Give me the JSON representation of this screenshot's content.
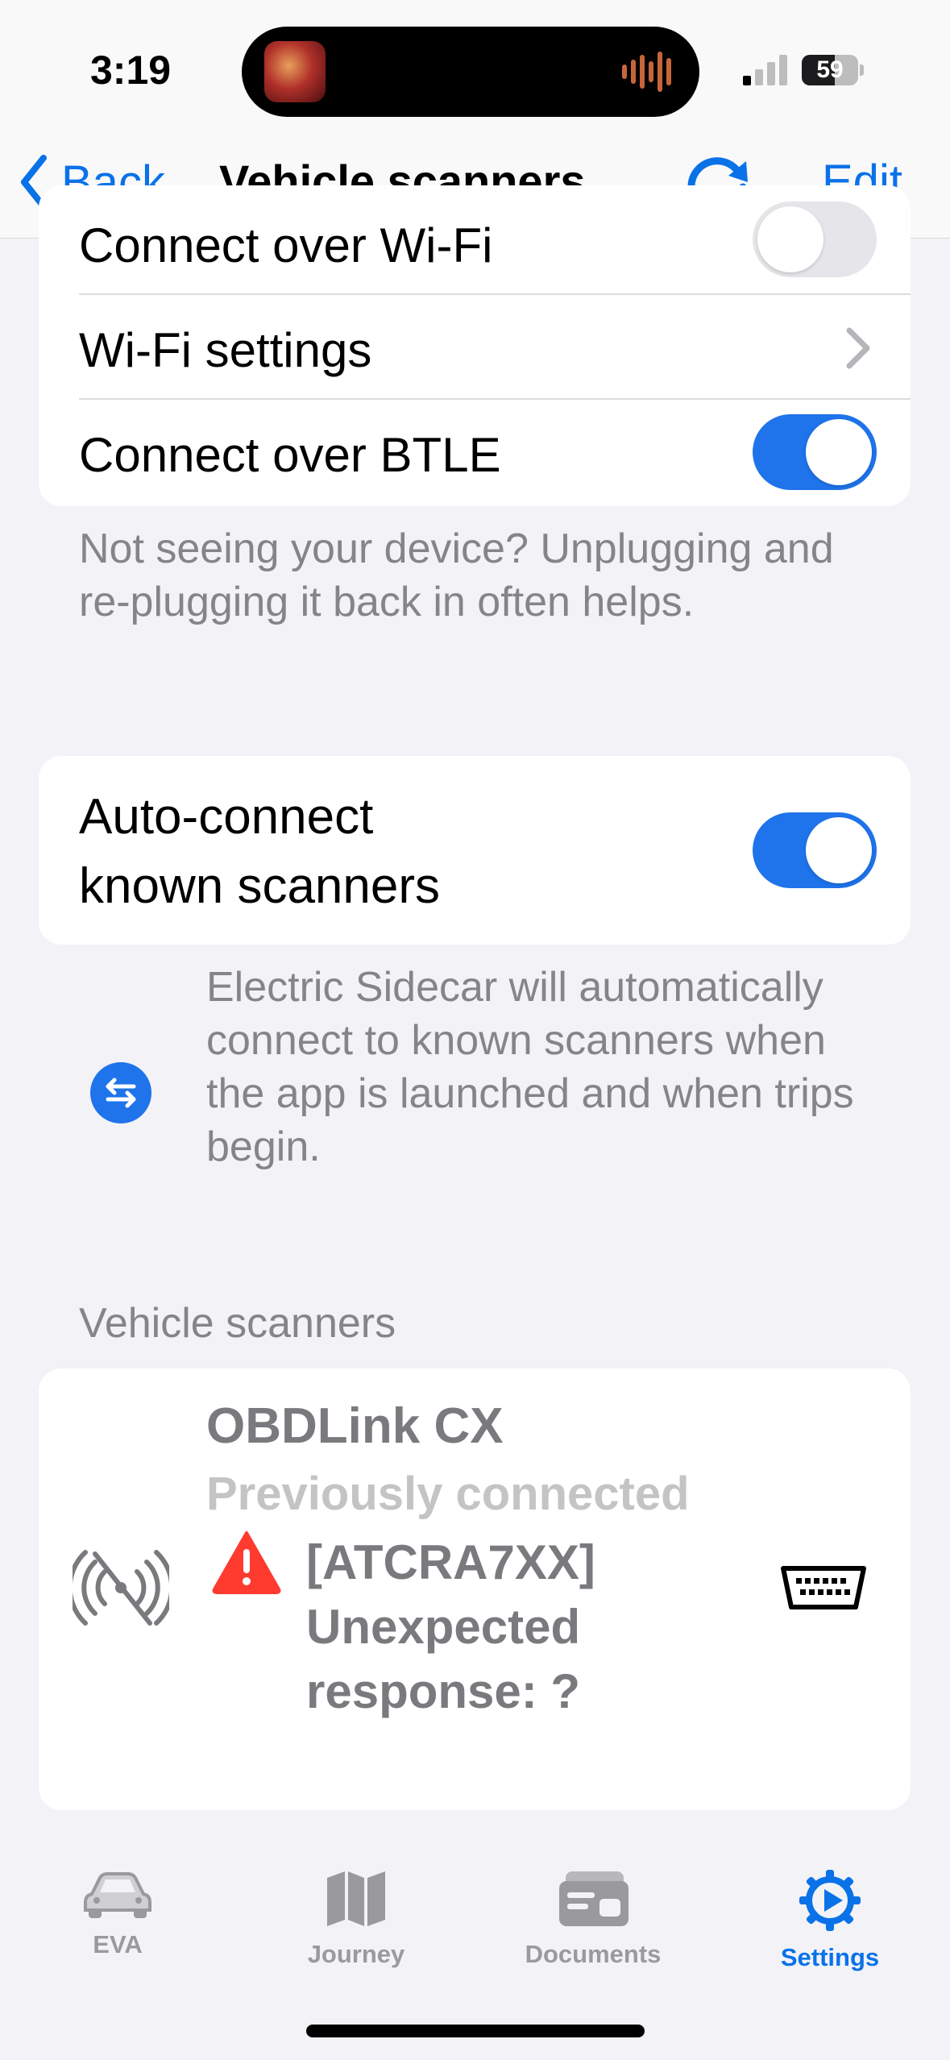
{
  "status_bar": {
    "time": "3:19",
    "battery_level": "59",
    "battery_fraction": 0.59
  },
  "nav": {
    "back_label": "Back",
    "title": "Vehicle scanners",
    "refresh_icon": "refresh-icon",
    "edit_label": "Edit"
  },
  "connection_settings": {
    "wifi_label": "Connect over Wi-Fi",
    "wifi_enabled": false,
    "wifi_settings_label": "Wi-Fi settings",
    "btle_label": "Connect over BTLE",
    "btle_enabled": true
  },
  "connection_footnote": "Not seeing your device? Unplugging and re-plugging it back in often helps.",
  "auto_connect": {
    "label_line1": "Auto-connect",
    "label_line2": "known scanners",
    "enabled": true,
    "footnote": "Electric Sidecar will automatically connect to known scanners when the app is launched and when trips begin.",
    "icon": "arrows-swap-icon"
  },
  "scanners_section": {
    "header": "Vehicle scanners",
    "items": [
      {
        "name": "OBDLink CX",
        "status": "Previously connected",
        "error_code": "[ATCRA7XX]",
        "error_line2": "Unexpected",
        "error_line3": "response: ?",
        "signal_icon": "signal-off-icon",
        "warning_icon": "warning-icon",
        "device_icon": "obd-connector-icon"
      }
    ]
  },
  "tab_bar": {
    "tabs": [
      {
        "label": "EVA",
        "icon": "car-icon",
        "active": false
      },
      {
        "label": "Journey",
        "icon": "map-icon",
        "active": false
      },
      {
        "label": "Documents",
        "icon": "documents-icon",
        "active": false
      },
      {
        "label": "Settings",
        "icon": "gear-icon",
        "active": true
      }
    ]
  },
  "colors": {
    "accent": "#0a72e8",
    "toggle_on": "#1f73eb",
    "warning": "#ff3b30",
    "secondary_text": "#858589",
    "background": "#f2f2f7"
  }
}
